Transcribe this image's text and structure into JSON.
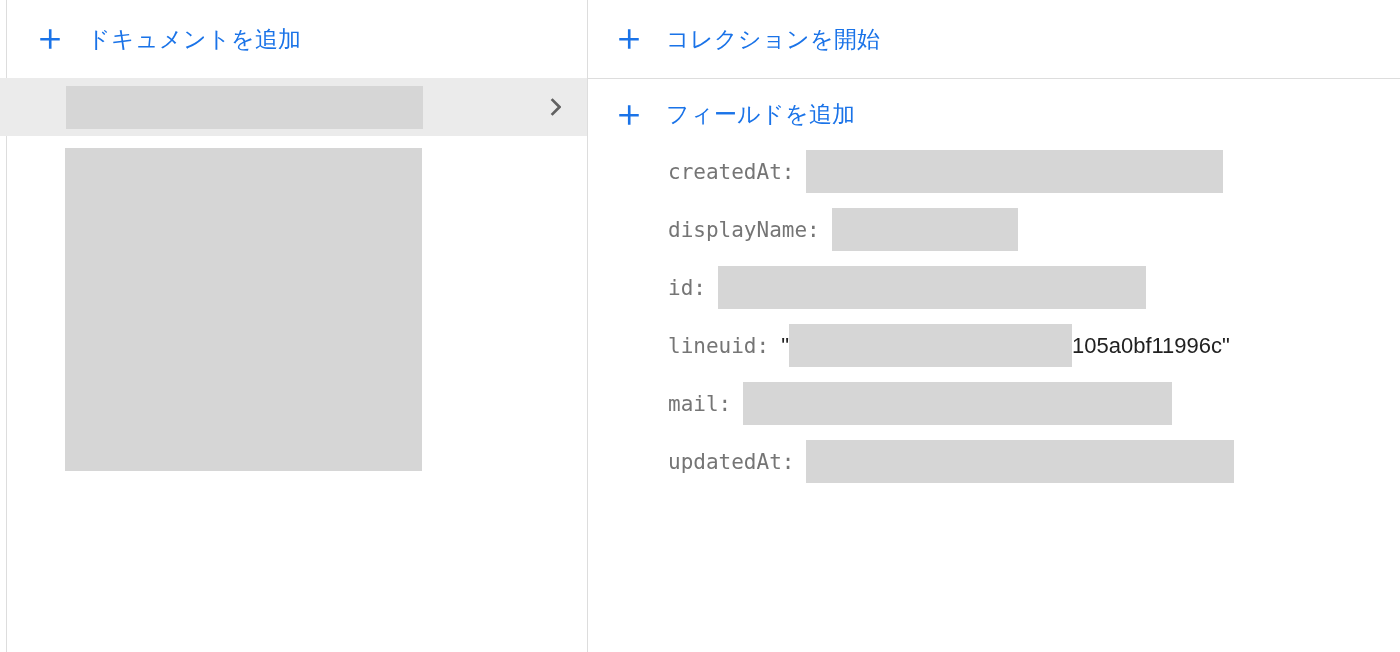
{
  "documents_panel": {
    "add_label": "ドキュメントを追加",
    "documents": [
      {
        "selected": true,
        "redacted": true
      }
    ],
    "more_documents_redacted": true
  },
  "detail_panel": {
    "collection_label": "コレクションを開始",
    "add_field_label": "フィールドを追加",
    "fields": [
      {
        "key": "createdAt:",
        "redacted": true
      },
      {
        "key": "displayName:",
        "redacted": true
      },
      {
        "key": "id:",
        "redacted": true
      },
      {
        "key": "lineuid:",
        "prefix": "\"",
        "redacted": true,
        "suffix": "105a0bf11996c\""
      },
      {
        "key": "mail:",
        "redacted": true
      },
      {
        "key": "updatedAt:",
        "redacted": true
      }
    ]
  }
}
